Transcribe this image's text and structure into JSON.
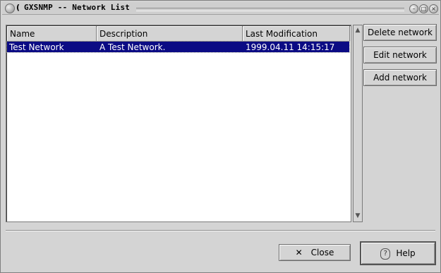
{
  "window": {
    "title_lead": "(",
    "title": "GXSNMP -- Network List",
    "controls": [
      "minimize",
      "maximize",
      "close"
    ]
  },
  "table": {
    "columns": [
      "Name",
      "Description",
      "Last Modification"
    ],
    "rows": [
      {
        "name": "Test Network",
        "description": "A Test Network.",
        "modified": "1999.04.11 14:15:17",
        "selected": true
      }
    ]
  },
  "buttons": {
    "delete": "Delete network",
    "edit": "Edit network",
    "add": "Add network",
    "close": "Close",
    "help": "Help"
  },
  "icons": {
    "close": "x-icon",
    "help": "question-icon"
  },
  "colors": {
    "selection": "#0b0b84",
    "background": "#d4d4d4"
  }
}
